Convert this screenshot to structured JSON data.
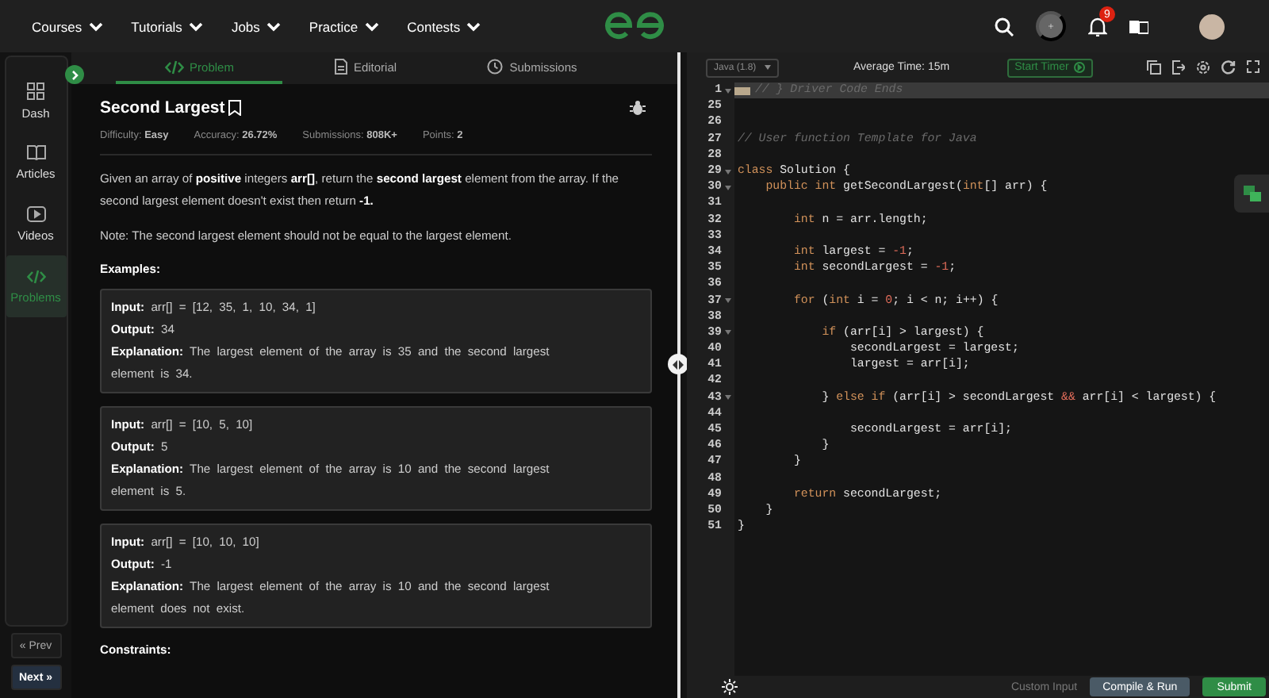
{
  "nav": {
    "items": [
      {
        "label": "Courses"
      },
      {
        "label": "Tutorials"
      },
      {
        "label": "Jobs"
      },
      {
        "label": "Practice"
      },
      {
        "label": "Contests"
      }
    ],
    "notification_count": "9"
  },
  "sidebar": {
    "items": [
      {
        "label": "Dash",
        "selected": false
      },
      {
        "label": "Articles",
        "selected": false
      },
      {
        "label": "Videos",
        "selected": false
      },
      {
        "label": "Problems",
        "selected": true
      }
    ],
    "prev": "« Prev",
    "next": "Next »"
  },
  "tabs": [
    {
      "label": "Problem",
      "selected": true
    },
    {
      "label": "Editorial",
      "selected": false
    },
    {
      "label": "Submissions",
      "selected": false
    }
  ],
  "problem": {
    "title": "Second Largest",
    "meta": [
      "Difficulty: **Easy**",
      "Accuracy: **26.72%**",
      "Submissions: **808K+**",
      "Points: **2**"
    ],
    "description": "Given an array of **positive** integers **arr[]**, return the **second largest** element from the array. If the second largest element doesn't exist then return **-1.**",
    "note": "Note: The second largest element should not be equal to the largest element.",
    "examples_heading": "Examples:",
    "examples": [
      {
        "input": "**Input:** arr[] = [12, 35, 1, 10, 34, 1]",
        "output": "**Output:** 34",
        "explanation": "**Explanation:** The largest element of the array is 35 and the second largest element is 34."
      },
      {
        "input": "**Input:** arr[] = [10, 5, 10]",
        "output": "**Output:** 5",
        "explanation": "**Explanation:** The largest element of the array is 10 and the second largest element is 5."
      },
      {
        "input": "**Input:** arr[] = [10, 10, 10]",
        "output": "**Output:** -1",
        "explanation": "**Explanation:** The largest element of the array is 10 and the second largest element does not exist."
      }
    ],
    "constraints_heading": "Constraints:"
  },
  "editor": {
    "language": "Java (1.8)",
    "average_time": "Average Time: 15m",
    "timer_button": "Start Timer",
    "lines": [
      {
        "number": "1",
        "fold": true,
        "selected": true,
        "tokens": [
          {
            "kind": "comment",
            "text": "// } Driver Code Ends"
          }
        ]
      },
      {
        "number": "25",
        "fold": false,
        "selected": false
      },
      {
        "number": "26",
        "fold": false,
        "selected": false
      },
      {
        "number": "27",
        "fold": false,
        "selected": false,
        "tokens": [
          {
            "kind": "comment",
            "text": "// User function Template for Java"
          }
        ]
      },
      {
        "number": "28",
        "fold": false,
        "selected": false
      },
      {
        "number": "29",
        "fold": true,
        "selected": false,
        "tokens": [
          {
            "kind": "keyword",
            "text": "class"
          },
          {
            "kind": "plain",
            "text": " Solution {"
          }
        ]
      },
      {
        "number": "30",
        "fold": true,
        "selected": false,
        "tokens": [
          {
            "kind": "keyword",
            "text": "    public int"
          },
          {
            "kind": "plain",
            "text": " getSecondLargest("
          },
          {
            "kind": "keyword",
            "text": "int"
          },
          {
            "kind": "plain",
            "text": "[] arr) {"
          }
        ]
      },
      {
        "number": "31",
        "fold": false,
        "selected": false
      },
      {
        "number": "32",
        "fold": false,
        "selected": false,
        "tokens": [
          {
            "kind": "keyword",
            "text": "        int"
          },
          {
            "kind": "plain",
            "text": " n = arr.length;"
          }
        ]
      },
      {
        "number": "33",
        "fold": false,
        "selected": false
      },
      {
        "number": "34",
        "fold": false,
        "selected": false,
        "tokens": [
          {
            "kind": "keyword",
            "text": "        int"
          },
          {
            "kind": "plain",
            "text": " largest = "
          },
          {
            "kind": "number",
            "text": "-1"
          },
          {
            "kind": "plain",
            "text": ";"
          }
        ]
      },
      {
        "number": "35",
        "fold": false,
        "selected": false,
        "tokens": [
          {
            "kind": "keyword",
            "text": "        int"
          },
          {
            "kind": "plain",
            "text": " secondLargest = "
          },
          {
            "kind": "number",
            "text": "-1"
          },
          {
            "kind": "plain",
            "text": ";"
          }
        ]
      },
      {
        "number": "36",
        "fold": false,
        "selected": false
      },
      {
        "number": "37",
        "fold": true,
        "selected": false,
        "tokens": [
          {
            "kind": "keyword",
            "text": "        for"
          },
          {
            "kind": "plain",
            "text": " ("
          },
          {
            "kind": "keyword",
            "text": "int"
          },
          {
            "kind": "plain",
            "text": " i = "
          },
          {
            "kind": "number",
            "text": "0"
          },
          {
            "kind": "plain",
            "text": "; i < n; i++) {"
          }
        ]
      },
      {
        "number": "38",
        "fold": false,
        "selected": false
      },
      {
        "number": "39",
        "fold": true,
        "selected": false,
        "tokens": [
          {
            "kind": "keyword",
            "text": "            if"
          },
          {
            "kind": "plain",
            "text": " (arr[i] > largest) {"
          }
        ]
      },
      {
        "number": "40",
        "fold": false,
        "selected": false,
        "tokens": [
          {
            "kind": "plain",
            "text": "                secondLargest = largest;"
          }
        ]
      },
      {
        "number": "41",
        "fold": false,
        "selected": false,
        "tokens": [
          {
            "kind": "plain",
            "text": "                largest = arr[i];"
          }
        ]
      },
      {
        "number": "42",
        "fold": false,
        "selected": false
      },
      {
        "number": "43",
        "fold": true,
        "selected": false,
        "tokens": [
          {
            "kind": "plain",
            "text": "            } "
          },
          {
            "kind": "keyword",
            "text": "else if"
          },
          {
            "kind": "plain",
            "text": " (arr[i] > secondLargest "
          },
          {
            "kind": "number",
            "text": "&&"
          },
          {
            "kind": "plain",
            "text": " arr[i] < largest) {"
          }
        ]
      },
      {
        "number": "44",
        "fold": false,
        "selected": false
      },
      {
        "number": "45",
        "fold": false,
        "selected": false,
        "tokens": [
          {
            "kind": "plain",
            "text": "                secondLargest = arr[i];"
          }
        ]
      },
      {
        "number": "46",
        "fold": false,
        "selected": false,
        "tokens": [
          {
            "kind": "plain",
            "text": "            }"
          }
        ]
      },
      {
        "number": "47",
        "fold": false,
        "selected": false,
        "tokens": [
          {
            "kind": "plain",
            "text": "        }"
          }
        ]
      },
      {
        "number": "48",
        "fold": false,
        "selected": false
      },
      {
        "number": "49",
        "fold": false,
        "selected": false,
        "tokens": [
          {
            "kind": "keyword",
            "text": "        return"
          },
          {
            "kind": "plain",
            "text": " secondLargest;"
          }
        ]
      },
      {
        "number": "50",
        "fold": false,
        "selected": false,
        "tokens": [
          {
            "kind": "plain",
            "text": "    }"
          }
        ]
      },
      {
        "number": "51",
        "fold": false,
        "selected": false,
        "tokens": [
          {
            "kind": "plain",
            "text": "}"
          }
        ]
      }
    ],
    "footer": {
      "custom_input": "Custom Input",
      "compile_button": "Compile & Run",
      "submit_button": "Submit"
    }
  }
}
